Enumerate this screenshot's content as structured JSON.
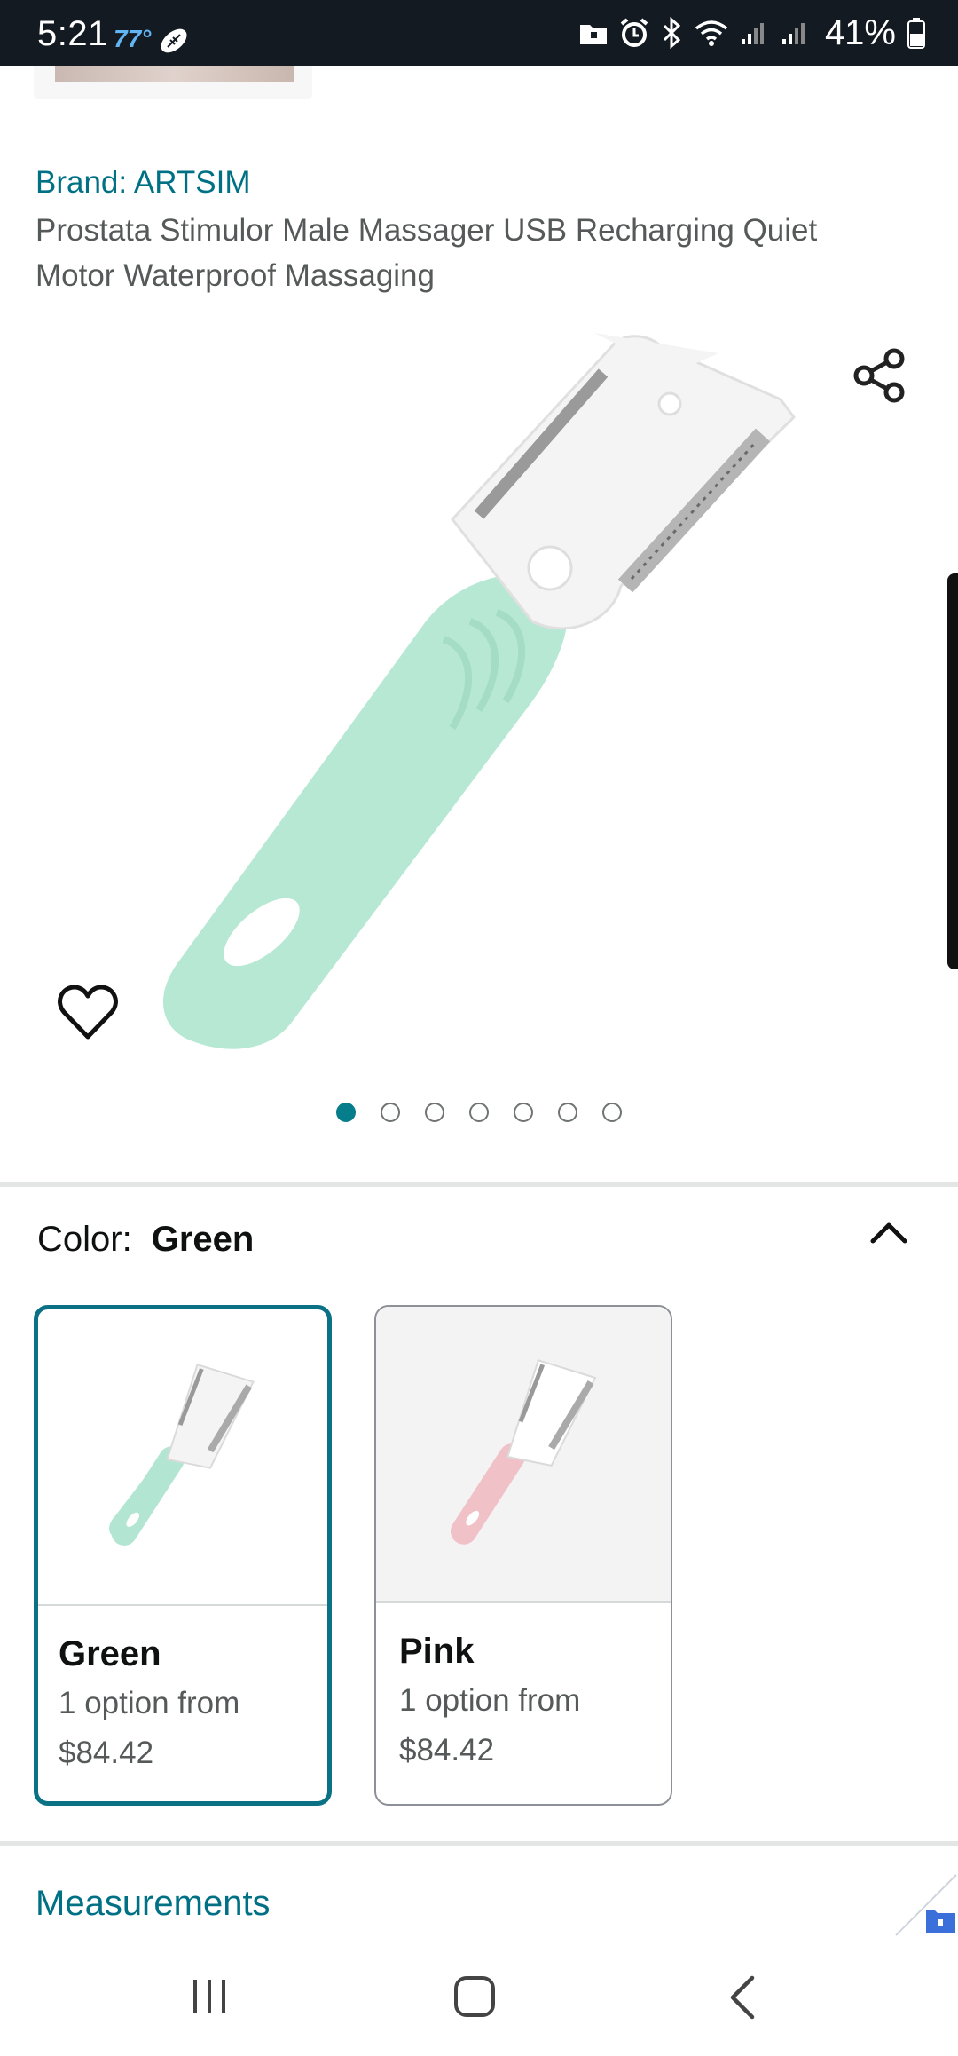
{
  "status_bar": {
    "time": "5:21",
    "temperature": "77°",
    "battery_percent": "41%"
  },
  "product": {
    "brand": "Brand: ARTSIM",
    "title": "Prostata Stimulor Male Massager USB Recharging Quiet Motor Waterproof Massaging",
    "image_count": 7,
    "active_image_index": 0
  },
  "variation": {
    "label": "Color:",
    "selected": "Green",
    "options": [
      {
        "name": "Green",
        "availability": "1 option from",
        "price": "$84.42",
        "handle_color": "#b3e6d2",
        "selected": true
      },
      {
        "name": "Pink",
        "availability": "1 option from",
        "price": "$84.42",
        "handle_color": "#f1c1c8",
        "selected": false
      }
    ]
  },
  "sections": {
    "measurements": "Measurements"
  },
  "colors": {
    "accent_teal": "#007185",
    "status_bar_bg": "#131a22",
    "selected_border": "#0b7285"
  },
  "icons": [
    "share-icon",
    "heart-icon",
    "chevron-up-icon",
    "recent-apps-icon",
    "home-icon",
    "back-icon"
  ]
}
